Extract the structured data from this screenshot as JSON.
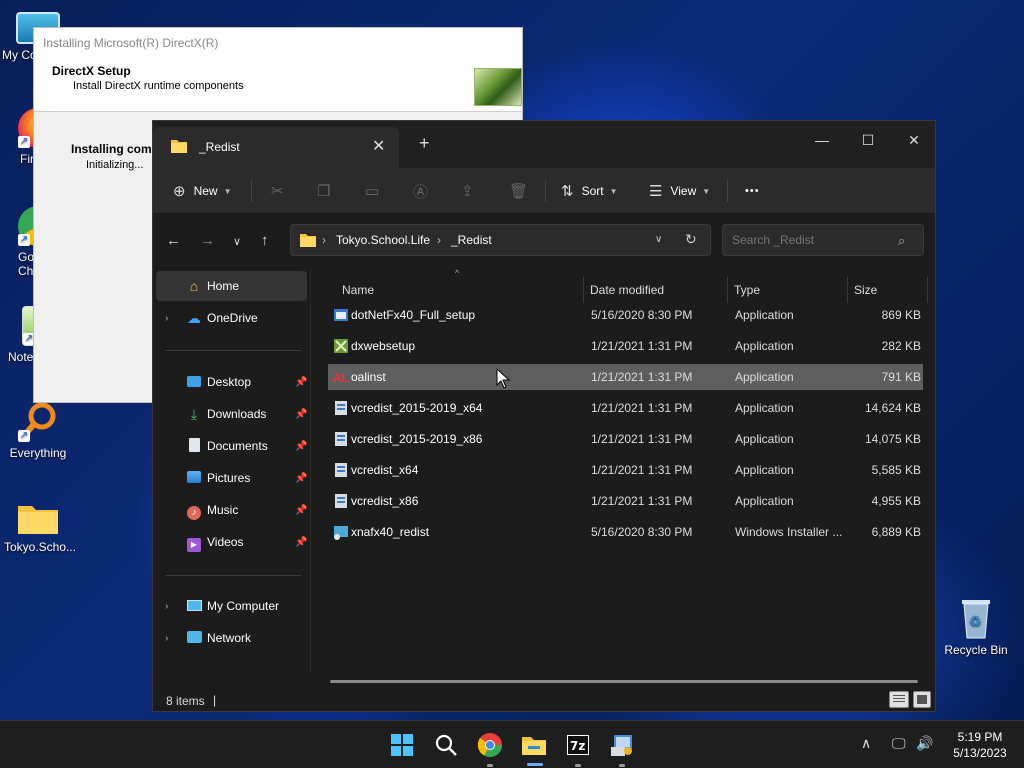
{
  "desktop": {
    "icons": [
      {
        "label": "My Co",
        "name": "my-computer"
      },
      {
        "label": "Fir",
        "name": "firefox"
      },
      {
        "label": "Go Chr",
        "name": "google-chrome"
      },
      {
        "label": "Note",
        "name": "notepad"
      },
      {
        "label": "Everything",
        "name": "everything"
      },
      {
        "label": "Tokyo.Scho...",
        "name": "tokyo-school-folder"
      }
    ],
    "recycle_bin": "Recycle Bin"
  },
  "directx": {
    "title": "Installing Microsoft(R) DirectX(R)",
    "header_title": "DirectX Setup",
    "header_sub": "Install DirectX runtime components",
    "body_title": "Installing comp",
    "body_sub": "Initializing..."
  },
  "explorer": {
    "tab_label": "_Redist",
    "toolbar": {
      "new_label": "New",
      "sort_label": "Sort",
      "view_label": "View",
      "more_label": "•••"
    },
    "address": {
      "crumb1": "Tokyo.School.Life",
      "crumb2": "_Redist"
    },
    "search_placeholder": "Search _Redist",
    "nav": {
      "home": "Home",
      "onedrive": "OneDrive",
      "desktop": "Desktop",
      "downloads": "Downloads",
      "documents": "Documents",
      "pictures": "Pictures",
      "music": "Music",
      "videos": "Videos",
      "my_computer": "My Computer",
      "network": "Network"
    },
    "columns": {
      "name": "Name",
      "date": "Date modified",
      "type": "Type",
      "size": "Size"
    },
    "files": [
      {
        "name": "dotNetFx40_Full_setup",
        "date": "5/16/2020 8:30 PM",
        "type": "Application",
        "size": "869 KB",
        "icon": "setup-app-icon"
      },
      {
        "name": "dxwebsetup",
        "date": "1/21/2021 1:31 PM",
        "type": "Application",
        "size": "282 KB",
        "icon": "dx-app-icon"
      },
      {
        "name": "oalinst",
        "date": "1/21/2021 1:31 PM",
        "type": "Application",
        "size": "791 KB",
        "icon": "openal-app-icon"
      },
      {
        "name": "vcredist_2015-2019_x64",
        "date": "1/21/2021 1:31 PM",
        "type": "Application",
        "size": "14,624 KB",
        "icon": "vcredist-icon"
      },
      {
        "name": "vcredist_2015-2019_x86",
        "date": "1/21/2021 1:31 PM",
        "type": "Application",
        "size": "14,075 KB",
        "icon": "vcredist-icon"
      },
      {
        "name": "vcredist_x64",
        "date": "1/21/2021 1:31 PM",
        "type": "Application",
        "size": "5,585 KB",
        "icon": "vcredist-icon"
      },
      {
        "name": "vcredist_x86",
        "date": "1/21/2021 1:31 PM",
        "type": "Application",
        "size": "4,955 KB",
        "icon": "vcredist-icon"
      },
      {
        "name": "xnafx40_redist",
        "date": "5/16/2020 8:30 PM",
        "type": "Windows Installer ...",
        "size": "6,889 KB",
        "icon": "msi-installer-icon"
      }
    ],
    "status": "8 items"
  },
  "taskbar": {
    "time": "5:19 PM",
    "date": "5/13/2023"
  }
}
